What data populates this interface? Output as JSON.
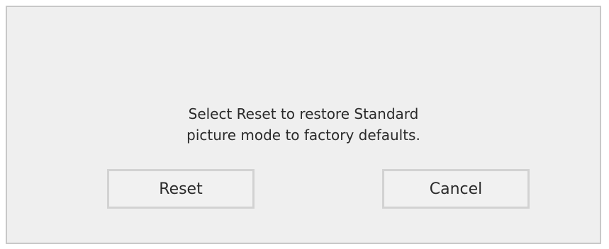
{
  "dialog": {
    "message_line1": "Select Reset to restore Standard",
    "message_line2": "picture mode to factory defaults.",
    "buttons": {
      "reset_label": "Reset",
      "cancel_label": "Cancel"
    }
  }
}
